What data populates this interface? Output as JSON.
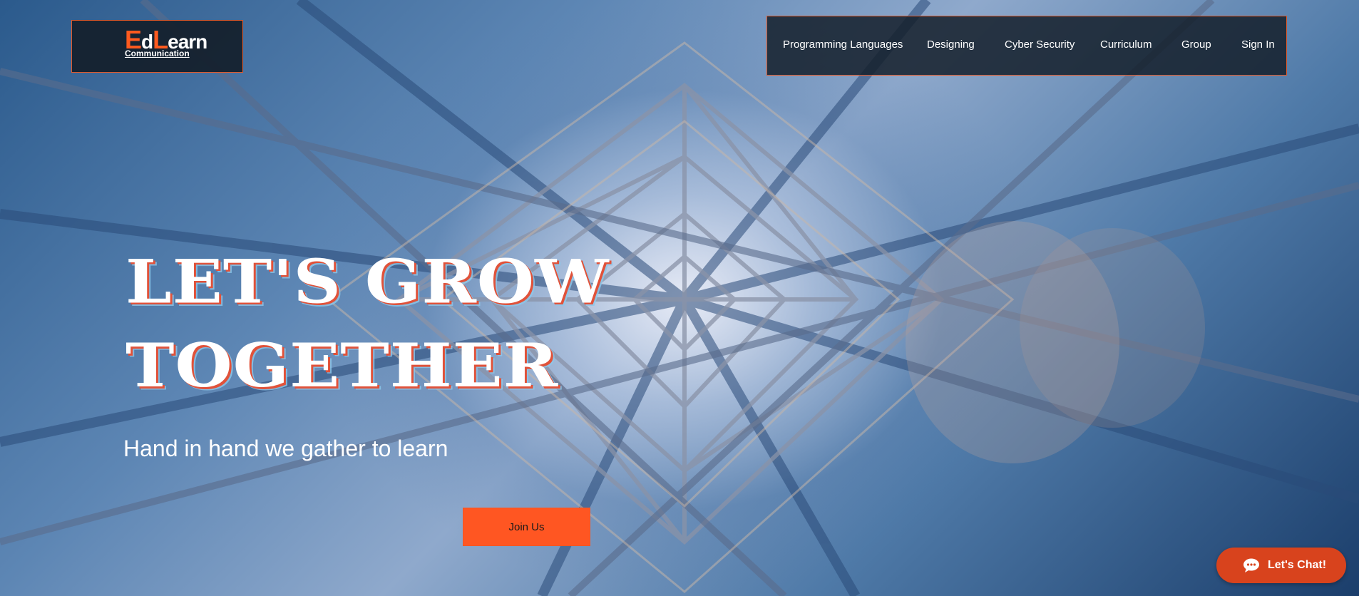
{
  "logo": {
    "initial_e": "E",
    "part_d": "d",
    "initial_l": "L",
    "part_earn": "earn",
    "subtitle": "Communication"
  },
  "nav": {
    "items": [
      {
        "label": "Programming Languages"
      },
      {
        "label": "Designing"
      },
      {
        "label": "Cyber Security"
      },
      {
        "label": "Curriculum"
      },
      {
        "label": "Group"
      },
      {
        "label": "Sign In"
      }
    ]
  },
  "hero": {
    "headline_line1": "LET'S GROW",
    "headline_line2": "TOGETHER",
    "subtitle": "Hand in hand we gather to learn",
    "cta_label": "Join Us"
  },
  "chat": {
    "label": "Let's Chat!",
    "icon": "chat-bubble-icon"
  },
  "colors": {
    "accent": "#ff5622",
    "border": "#e05a2b",
    "chat": "#d8431d"
  }
}
